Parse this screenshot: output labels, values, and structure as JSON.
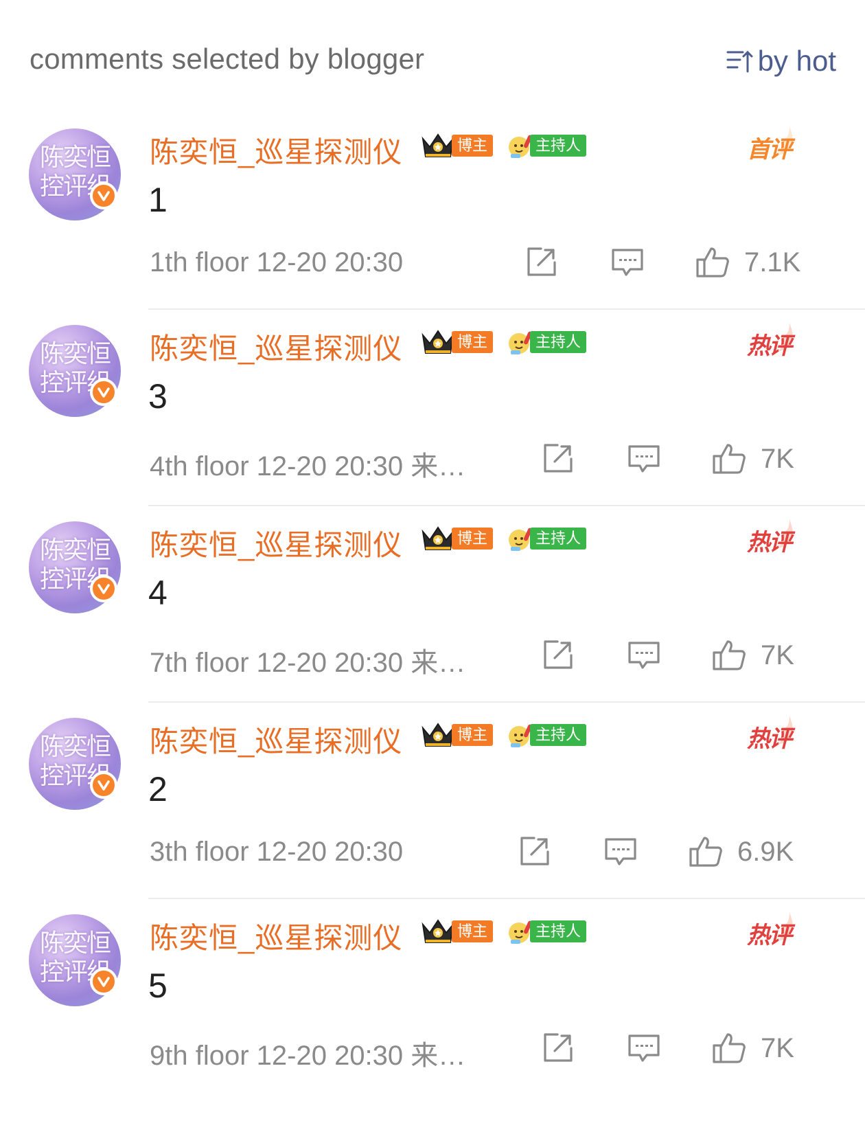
{
  "header": {
    "title": "comments selected by blogger",
    "sort_label": "by hot"
  },
  "colors": {
    "username": "#e86d25",
    "first_badge": "#f5862b",
    "hot_badge": "#e0413f",
    "blogger_tag": "#f47b25",
    "host_tag": "#3ab54a",
    "verified": "#f7842a",
    "meta": "#8a8a8a"
  },
  "comments": [
    {
      "avatar_text": "陈奕恒控评组",
      "username": "陈奕恒_巡星探测仪",
      "blogger_tag": "博主",
      "host_tag": "主持人",
      "label": "首评",
      "label_kind": "first",
      "content": "1",
      "meta": "1th floor 12-20 20:30",
      "likes": "7.1K"
    },
    {
      "avatar_text": "陈奕恒控评组",
      "username": "陈奕恒_巡星探测仪",
      "blogger_tag": "博主",
      "host_tag": "主持人",
      "label": "热评",
      "label_kind": "hot",
      "content": "3",
      "meta": "4th floor 12-20 20:30  来…",
      "likes": "7K"
    },
    {
      "avatar_text": "陈奕恒控评组",
      "username": "陈奕恒_巡星探测仪",
      "blogger_tag": "博主",
      "host_tag": "主持人",
      "label": "热评",
      "label_kind": "hot",
      "content": "4",
      "meta": "7th floor 12-20 20:30  来…",
      "likes": "7K"
    },
    {
      "avatar_text": "陈奕恒控评组",
      "username": "陈奕恒_巡星探测仪",
      "blogger_tag": "博主",
      "host_tag": "主持人",
      "label": "热评",
      "label_kind": "hot",
      "content": "2",
      "meta": "3th floor 12-20 20:30",
      "likes": "6.9K"
    },
    {
      "avatar_text": "陈奕恒控评组",
      "username": "陈奕恒_巡星探测仪",
      "blogger_tag": "博主",
      "host_tag": "主持人",
      "label": "热评",
      "label_kind": "hot",
      "content": "5",
      "meta": "9th floor 12-20 20:30  来…",
      "likes": "7K"
    }
  ]
}
